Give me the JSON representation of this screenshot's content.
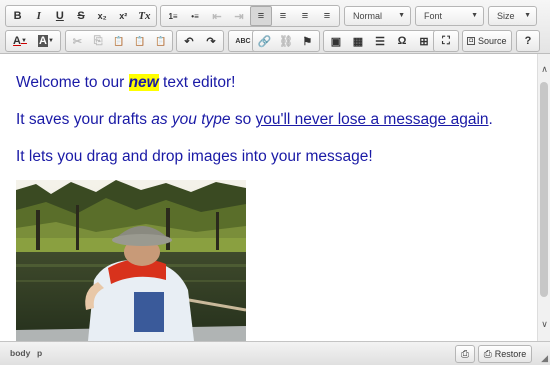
{
  "toolbar": {
    "row1": [
      "B",
      "I",
      "U",
      "S",
      "x₂",
      "x²",
      "Tx",
      "1≡",
      "•≡",
      "⇤",
      "⇥",
      "≡",
      "≡",
      "≡",
      "≡"
    ],
    "format_combo": "Normal",
    "font_combo": "Font",
    "size_combo": "Size",
    "row2": [
      "A",
      "A",
      "✂",
      "⎘",
      "📋",
      "📋",
      "📋",
      "↶",
      "↷",
      "ABC",
      "🔗",
      "⛓",
      "⚑",
      "▣",
      "▦",
      "☰",
      "Ω",
      "⊞",
      "⛶"
    ],
    "source_label": "Source",
    "help_label": "?"
  },
  "content": {
    "line1_before": "Welcome to our ",
    "line1_highlight": "new",
    "line1_after": " text editor!",
    "line2_before": "It saves your drafts ",
    "line2_italic": "as you type",
    "line2_middle": " so ",
    "line2_underline": "you'll never lose a message again",
    "line2_end": ".",
    "line3": "It lets you drag and drop images into your message!"
  },
  "statusbar": {
    "path": [
      "body",
      "p"
    ],
    "restore_label": "Restore"
  },
  "colors": {
    "text": "#1a1aa6",
    "highlight": "#ffff00"
  }
}
